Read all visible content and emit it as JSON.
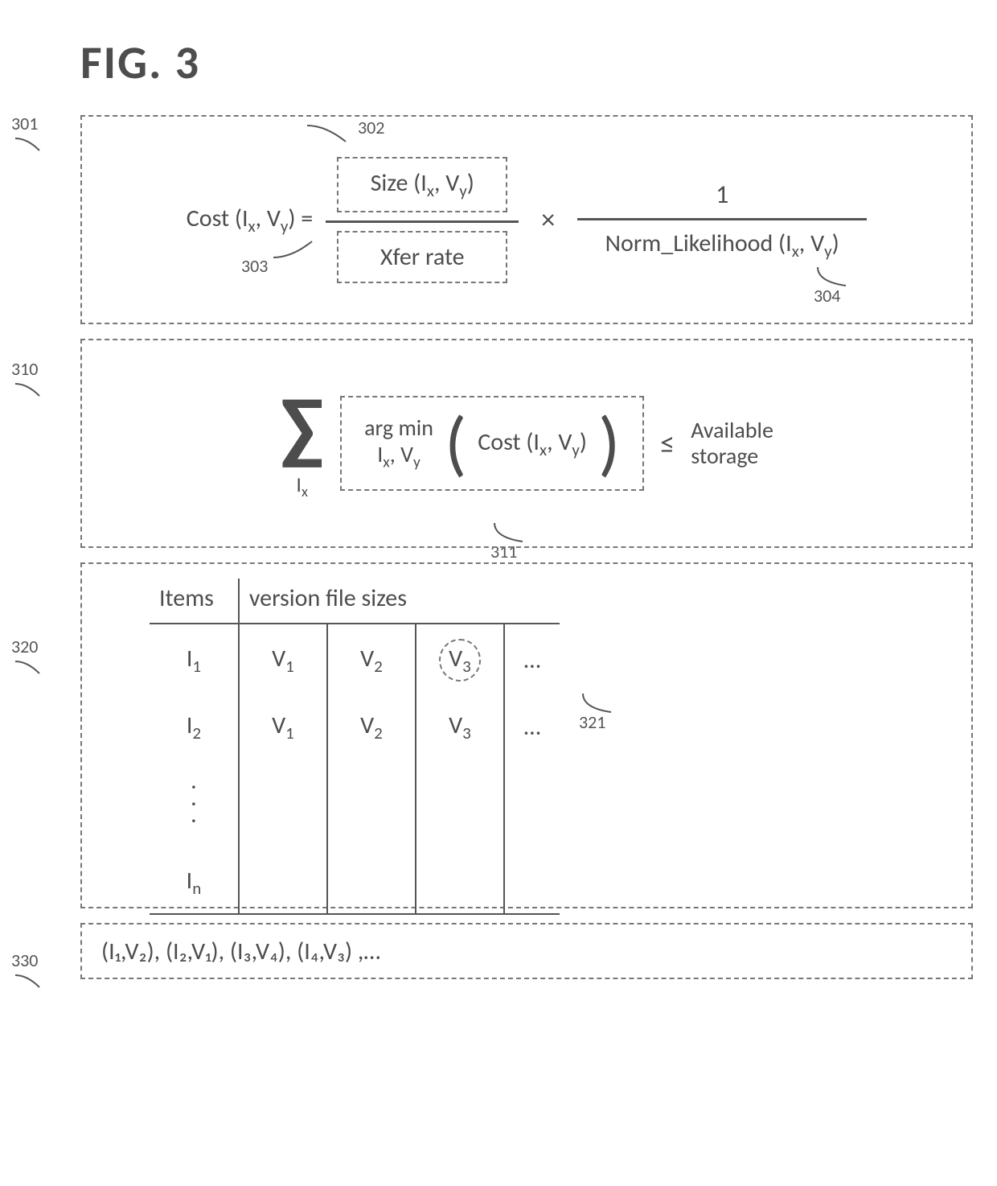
{
  "title": "FIG. 3",
  "callouts": {
    "c301": "301",
    "c302": "302",
    "c303": "303",
    "c304": "304",
    "c310": "310",
    "c311": "311",
    "c320": "320",
    "c321": "321",
    "c330": "330"
  },
  "box301": {
    "lhs_text": "Cost (I",
    "lhs_sub1": "x",
    "lhs_mid": ", V",
    "lhs_sub2": "y",
    "lhs_end": ") =",
    "size_label": "Size (I",
    "size_sub1": "x",
    "size_mid": ", V",
    "size_sub2": "y",
    "size_end": ")",
    "xfer_label": "Xfer rate",
    "times": "×",
    "one": "1",
    "norm_label": "Norm_Likelihood (I",
    "norm_sub1": "x",
    "norm_mid": ", V",
    "norm_sub2": "y",
    "norm_end": ")"
  },
  "box310": {
    "sigma": "∑",
    "sigma_sub_pre": "I",
    "sigma_sub": "x",
    "argmin_top": "arg min",
    "argmin_bot_pre": "I",
    "argmin_bot_sub1": "x",
    "argmin_bot_mid": ", V",
    "argmin_bot_sub2": "y",
    "lparen": "(",
    "rparen": ")",
    "cost_label": "Cost (I",
    "cost_sub1": "x",
    "cost_mid": ", V",
    "cost_sub2": "y",
    "cost_end": ")",
    "le": "≤",
    "available1": "Available",
    "available2": "storage"
  },
  "box320": {
    "hdr_items": "Items",
    "hdr_vfs": "version file sizes",
    "rows": [
      {
        "item": "I",
        "sub": "1",
        "v1": "V",
        "v1s": "1",
        "v2": "V",
        "v2s": "2",
        "v3": "V",
        "v3s": "3",
        "ell": "…",
        "circled": true
      },
      {
        "item": "I",
        "sub": "2",
        "v1": "V",
        "v1s": "1",
        "v2": "V",
        "v2s": "2",
        "v3": "V",
        "v3s": "3",
        "ell": "…",
        "circled": false
      }
    ],
    "row_last_item": "I",
    "row_last_sub": "n"
  },
  "box330": {
    "text": "(I₁,V₂), (I₂,V₁), (I₃,V₄), (I₄,V₃) ,…"
  }
}
